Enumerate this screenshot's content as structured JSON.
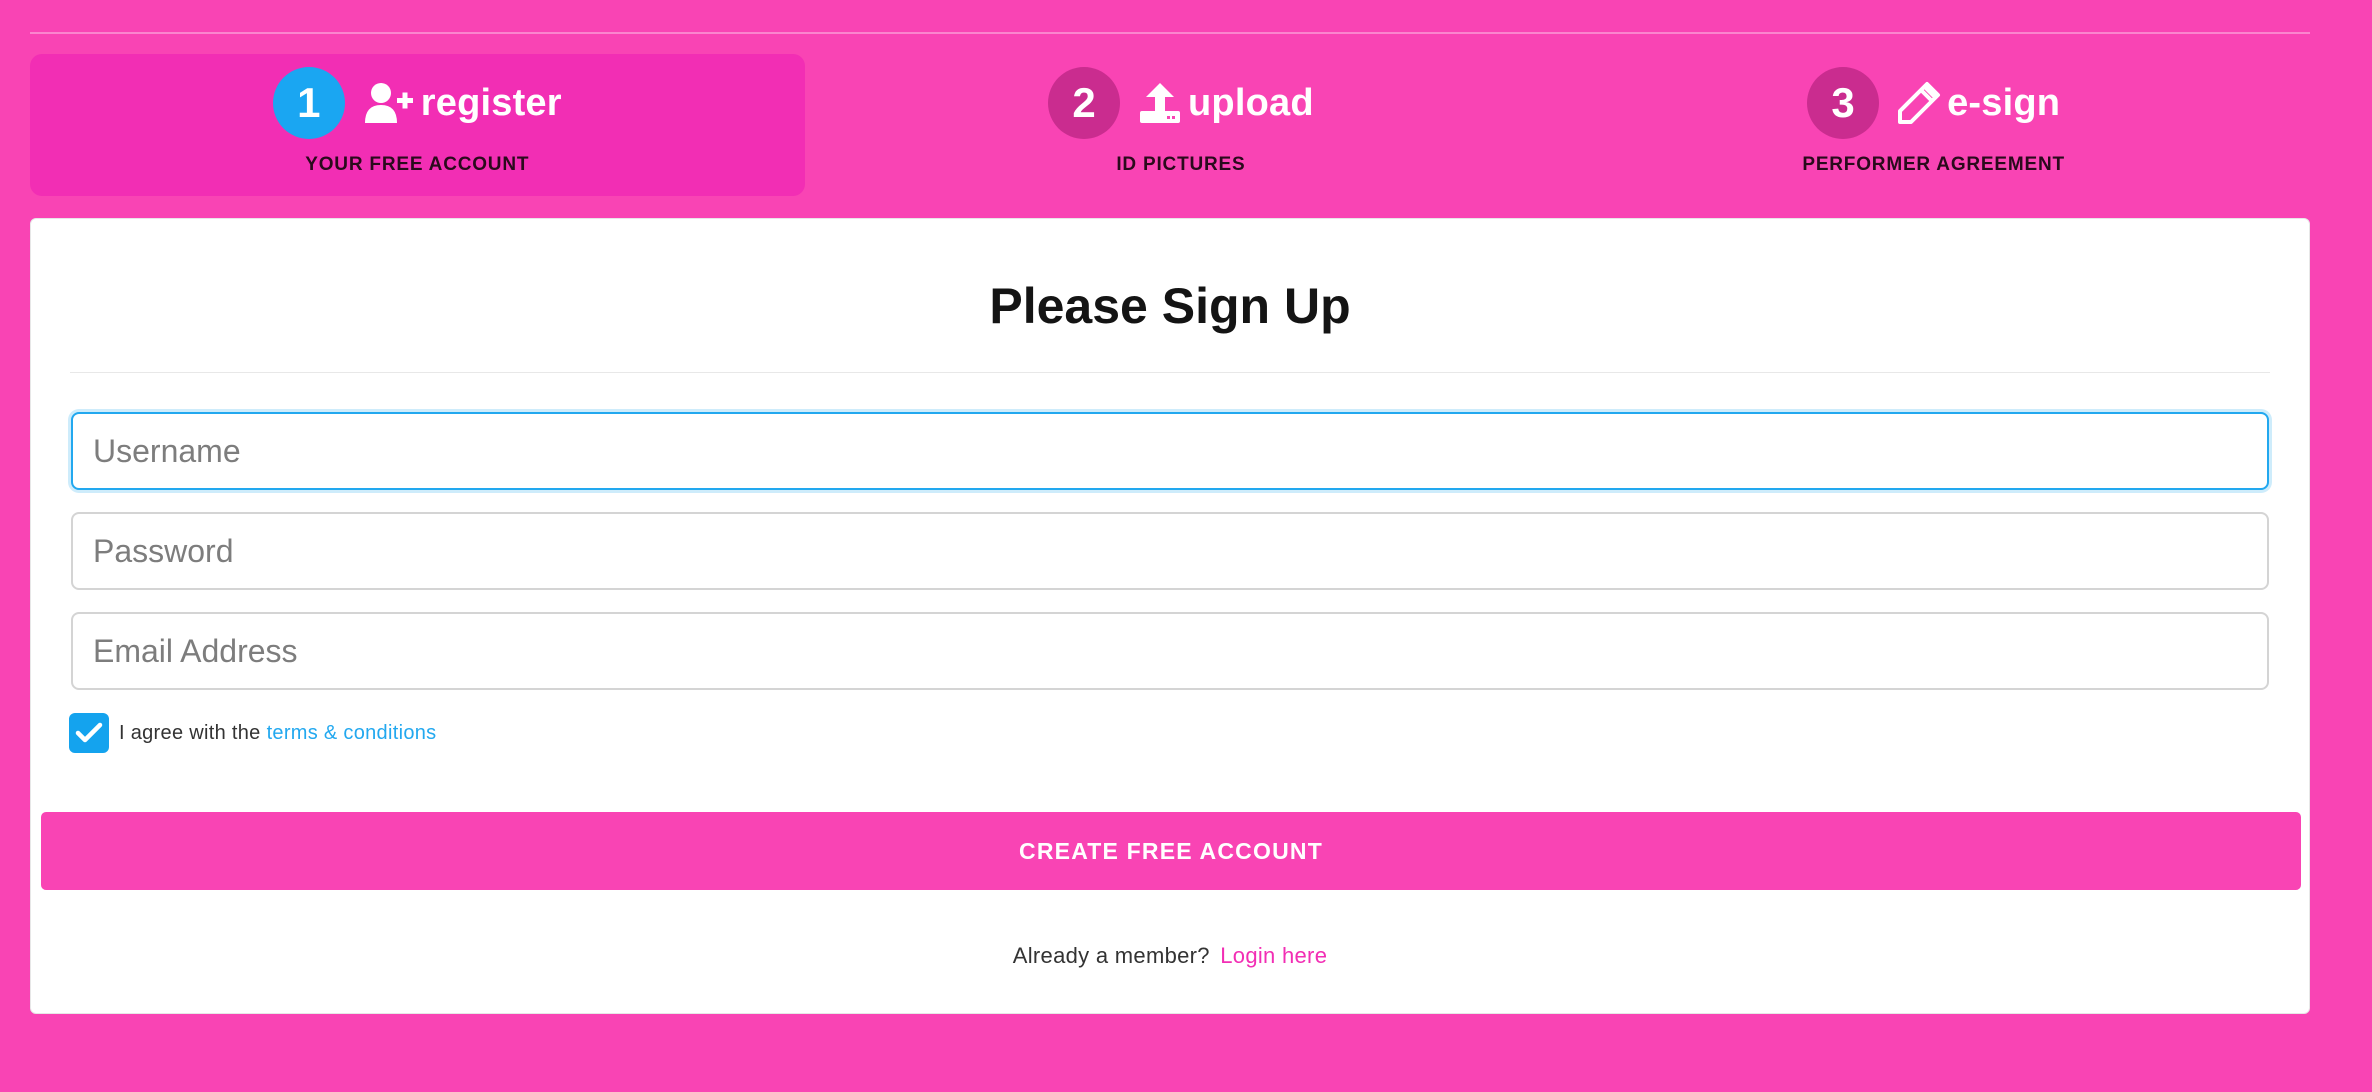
{
  "colors": {
    "page_bg": "#f944b4",
    "active_step_bg": "#f22eb4",
    "active_step_number": "#1aa6f2",
    "focus_border": "#22a8ef",
    "button_bg": "#f944b4",
    "link_blue": "#22a8ef",
    "link_pink": "#f22eb4"
  },
  "steps": [
    {
      "number": "1",
      "icon": "user-plus-icon",
      "title": "register",
      "subtitle": "YOUR FREE ACCOUNT",
      "active": true
    },
    {
      "number": "2",
      "icon": "upload-icon",
      "title": "upload",
      "subtitle": "ID PICTURES",
      "active": false
    },
    {
      "number": "3",
      "icon": "pencil-icon",
      "title": "e-sign",
      "subtitle": "PERFORMER AGREEMENT",
      "active": false
    }
  ],
  "form": {
    "title": "Please Sign Up",
    "username": {
      "value": "",
      "placeholder": "Username",
      "focused": true
    },
    "password": {
      "value": "",
      "placeholder": "Password"
    },
    "email": {
      "value": "",
      "placeholder": "Email Address"
    },
    "agree": {
      "checked": true,
      "text": "I agree with the",
      "link": "terms & conditions"
    },
    "submit_label": "CREATE FREE ACCOUNT",
    "member_text": "Already a member?",
    "login_link": "Login here"
  }
}
